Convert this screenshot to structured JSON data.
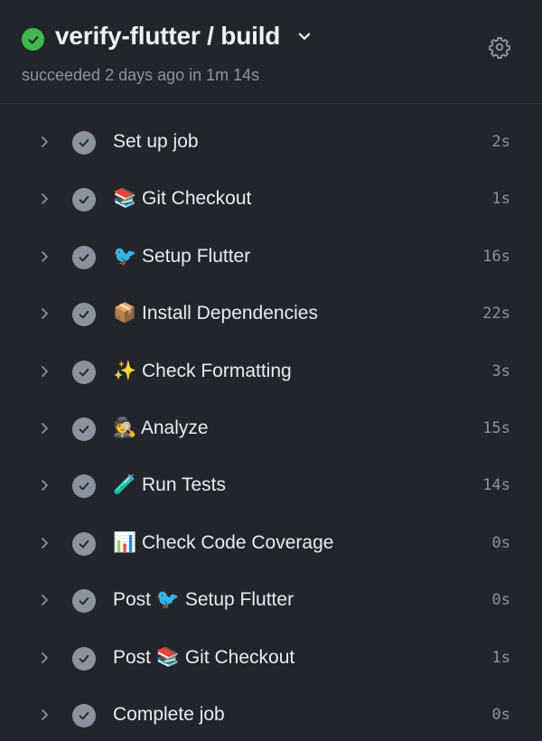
{
  "header": {
    "title": "verify-flutter / build",
    "subtitle": "succeeded 2 days ago in 1m 14s",
    "status_icon": "check-circle-icon",
    "status_color": "#3fb950",
    "menu_icon": "chevron-down-icon",
    "settings_icon": "gear-icon"
  },
  "steps": [
    {
      "label": "Set up job",
      "duration": "2s"
    },
    {
      "label": "📚 Git Checkout",
      "duration": "1s"
    },
    {
      "label": "🐦 Setup Flutter",
      "duration": "16s"
    },
    {
      "label": "📦 Install Dependencies",
      "duration": "22s"
    },
    {
      "label": "✨ Check Formatting",
      "duration": "3s"
    },
    {
      "label": "🕵️ Analyze",
      "duration": "15s"
    },
    {
      "label": "🧪 Run Tests",
      "duration": "14s"
    },
    {
      "label": "📊 Check Code Coverage",
      "duration": "0s"
    },
    {
      "label": "Post 🐦 Setup Flutter",
      "duration": "0s"
    },
    {
      "label": "Post 📚 Git Checkout",
      "duration": "1s"
    },
    {
      "label": "Complete job",
      "duration": "0s"
    }
  ],
  "colors": {
    "background": "#22252b",
    "text": "#e6edf3",
    "muted": "#8b949e",
    "success": "#3fb950"
  }
}
